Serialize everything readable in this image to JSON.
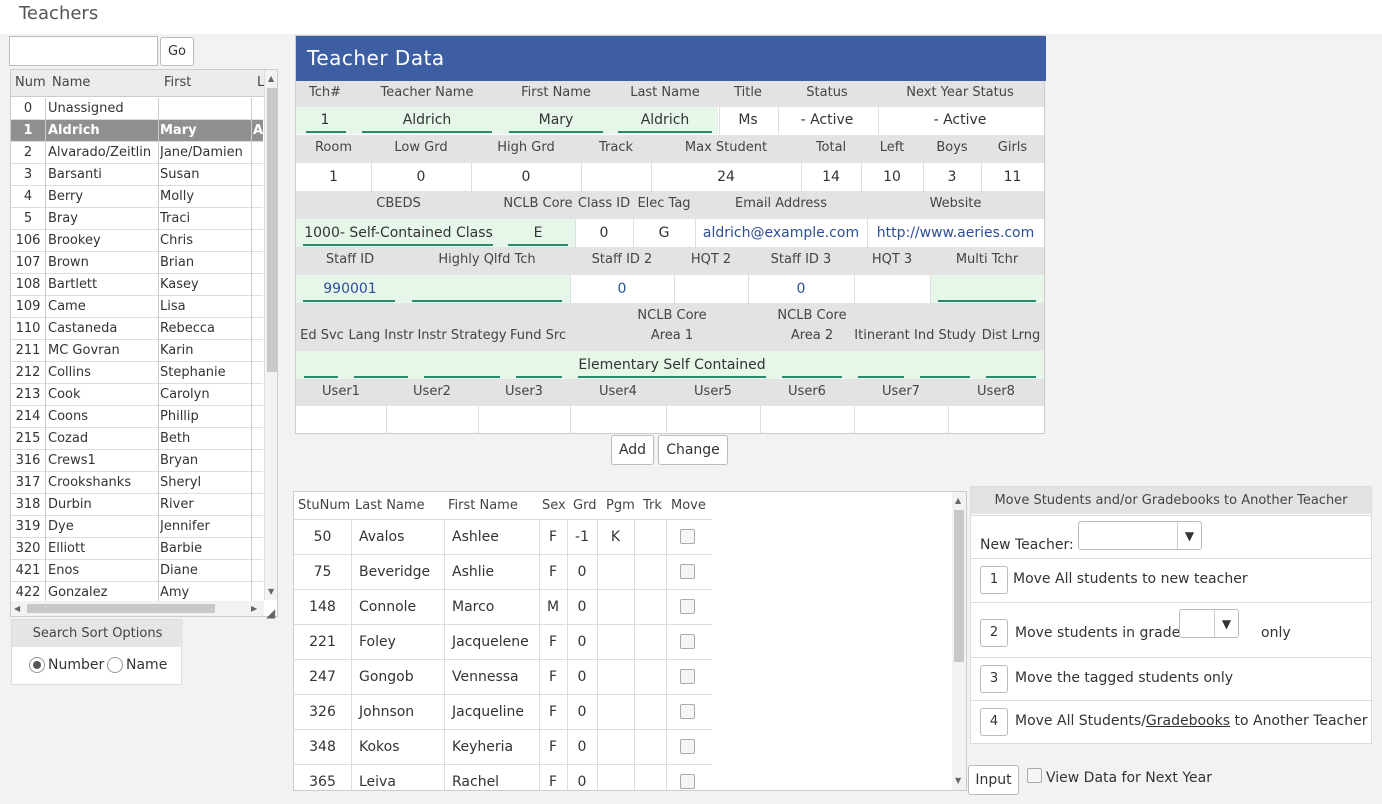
{
  "page": {
    "title": "Teachers"
  },
  "search": {
    "value": "",
    "go_label": "Go"
  },
  "teacher_list": {
    "headers": [
      "Num",
      "Name",
      "First",
      "L"
    ],
    "rows": [
      {
        "num": "0",
        "name": "Unassigned",
        "first": "",
        "l": ""
      },
      {
        "num": "1",
        "name": "Aldrich",
        "first": "Mary",
        "l": "A",
        "selected": true
      },
      {
        "num": "2",
        "name": "Alvarado/Zeitlin",
        "first": "Jane/Damien",
        "l": ""
      },
      {
        "num": "3",
        "name": "Barsanti",
        "first": "Susan",
        "l": ""
      },
      {
        "num": "4",
        "name": "Berry",
        "first": "Molly",
        "l": ""
      },
      {
        "num": "5",
        "name": "Bray",
        "first": "Traci",
        "l": ""
      },
      {
        "num": "106",
        "name": "Brookey",
        "first": "Chris",
        "l": ""
      },
      {
        "num": "107",
        "name": "Brown",
        "first": "Brian",
        "l": ""
      },
      {
        "num": "108",
        "name": "Bartlett",
        "first": "Kasey",
        "l": ""
      },
      {
        "num": "109",
        "name": "Came",
        "first": "Lisa",
        "l": ""
      },
      {
        "num": "110",
        "name": "Castaneda",
        "first": "Rebecca",
        "l": ""
      },
      {
        "num": "211",
        "name": "MC Govran",
        "first": "Karin",
        "l": ""
      },
      {
        "num": "212",
        "name": "Collins",
        "first": "Stephanie",
        "l": ""
      },
      {
        "num": "213",
        "name": "Cook",
        "first": "Carolyn",
        "l": ""
      },
      {
        "num": "214",
        "name": "Coons",
        "first": "Phillip",
        "l": ""
      },
      {
        "num": "215",
        "name": "Cozad",
        "first": "Beth",
        "l": ""
      },
      {
        "num": "316",
        "name": "Crews1",
        "first": "Bryan",
        "l": ""
      },
      {
        "num": "317",
        "name": "Crookshanks",
        "first": "Sheryl",
        "l": ""
      },
      {
        "num": "318",
        "name": "Durbin",
        "first": "River",
        "l": ""
      },
      {
        "num": "319",
        "name": "Dye",
        "first": "Jennifer",
        "l": ""
      },
      {
        "num": "320",
        "name": "Elliott",
        "first": "Barbie",
        "l": ""
      },
      {
        "num": "421",
        "name": "Enos",
        "first": "Diane",
        "l": ""
      },
      {
        "num": "422",
        "name": "Gonzalez",
        "first": "Amy",
        "l": ""
      }
    ]
  },
  "sort_options": {
    "title": "Search Sort Options",
    "number_label": "Number",
    "name_label": "Name",
    "selected": "Number"
  },
  "teacher_data": {
    "title": "Teacher Data",
    "r1_labels": [
      "Tch#",
      "Teacher Name",
      "First Name",
      "Last Name",
      "Title",
      "Status",
      "Next Year Status"
    ],
    "r1_values": [
      "1",
      "Aldrich",
      "Mary",
      "Aldrich",
      "Ms",
      "- Active",
      "- Active"
    ],
    "r2_labels": [
      "Room",
      "Low Grd",
      "High Grd",
      "Track",
      "Max Student",
      "Total",
      "Left",
      "Boys",
      "Girls"
    ],
    "r2_values": [
      "1",
      "0",
      "0",
      "",
      "24",
      "14",
      "10",
      "3",
      "11"
    ],
    "r3_labels": [
      "CBEDS",
      "NCLB Core",
      "Class ID",
      "Elec Tag",
      "Email Address",
      "Website"
    ],
    "r3_values": [
      "1000- Self-Contained Class",
      "E",
      "0",
      "G",
      "aldrich@example.com",
      "http://www.aeries.com"
    ],
    "r4_labels": [
      "Staff ID",
      "Highly Qlfd Tch",
      "Staff ID 2",
      "HQT 2",
      "Staff ID 3",
      "HQT 3",
      "Multi Tchr"
    ],
    "r4_values": [
      "990001",
      "",
      "0",
      "",
      "0",
      "",
      ""
    ],
    "r5_labels": [
      "Ed Svc",
      "Lang Instr",
      "Instr Strategy",
      "Fund Src",
      "NCLB Core",
      "Area 1",
      "NCLB Core",
      "Area 2",
      "Itinerant",
      "Ind Study",
      "Dist Lrng"
    ],
    "r5_values": [
      "",
      "",
      "",
      "",
      "Elementary Self Contained",
      "",
      "",
      "",
      ""
    ],
    "r6_labels": [
      "User1",
      "User2",
      "User3",
      "User4",
      "User5",
      "User6",
      "User7",
      "User8"
    ],
    "add_label": "Add",
    "change_label": "Change"
  },
  "students": {
    "headers": [
      "StuNum",
      "Last Name",
      "First Name",
      "Sex",
      "Grd",
      "Pgm",
      "Trk",
      "Move"
    ],
    "rows": [
      {
        "num": "50",
        "last": "Avalos",
        "first": "Ashlee",
        "sex": "F",
        "grd": "-1",
        "pgm": "K",
        "trk": ""
      },
      {
        "num": "75",
        "last": "Beveridge",
        "first": "Ashlie",
        "sex": "F",
        "grd": "0",
        "pgm": "",
        "trk": ""
      },
      {
        "num": "148",
        "last": "Connole",
        "first": "Marco",
        "sex": "M",
        "grd": "0",
        "pgm": "",
        "trk": ""
      },
      {
        "num": "221",
        "last": "Foley",
        "first": "Jacquelene",
        "sex": "F",
        "grd": "0",
        "pgm": "",
        "trk": ""
      },
      {
        "num": "247",
        "last": "Gongob",
        "first": "Vennessa",
        "sex": "F",
        "grd": "0",
        "pgm": "",
        "trk": ""
      },
      {
        "num": "326",
        "last": "Johnson",
        "first": "Jacqueline",
        "sex": "F",
        "grd": "0",
        "pgm": "",
        "trk": ""
      },
      {
        "num": "348",
        "last": "Kokos",
        "first": "Keyheria",
        "sex": "F",
        "grd": "0",
        "pgm": "",
        "trk": ""
      },
      {
        "num": "365",
        "last": "Leiva",
        "first": "Rachel",
        "sex": "F",
        "grd": "0",
        "pgm": "",
        "trk": ""
      }
    ]
  },
  "move_panel": {
    "title": "Move Students and/or Gradebooks to Another Teacher",
    "new_teacher_label": "New Teacher:",
    "new_teacher_value": "",
    "opt1_num": "1",
    "opt1_text": "Move All students to new teacher",
    "opt2_num": "2",
    "opt2_text": "Move students in grade",
    "opt2_suffix": "only",
    "grade_value": "",
    "opt3_num": "3",
    "opt3_text": "Move the tagged students only",
    "opt4_num": "4",
    "opt4_pre": "Move All Students/",
    "opt4_link": "Gradebooks",
    "opt4_post": " to Another Teacher"
  },
  "footer": {
    "input_label": "Input",
    "next_year_label": "View Data for Next Year"
  },
  "colors": {
    "header_blue": "#3e5ea3",
    "field_green": "#e6f7e9",
    "underline": "#2b8a6e",
    "selected_row": "#909090"
  }
}
